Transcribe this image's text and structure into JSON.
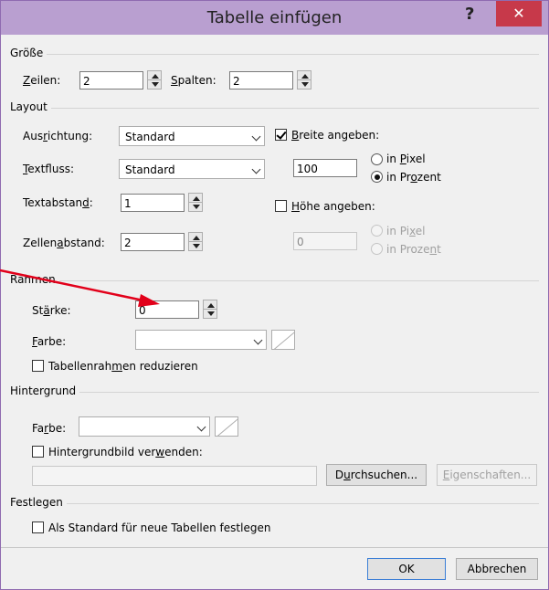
{
  "window": {
    "title": "Tabelle einfügen",
    "help": "?",
    "close": "✕"
  },
  "groesse": {
    "group": "Größe",
    "zeilen_label": "Zeilen:",
    "zeilen_value": "2",
    "spalten_label": "Spalten:",
    "spalten_value": "2"
  },
  "layout": {
    "group": "Layout",
    "ausrichtung_label": "Ausrichtung:",
    "ausrichtung_value": "Standard",
    "textfluss_label": "Textfluss:",
    "textfluss_value": "Standard",
    "textabstand_label": "Textabstand:",
    "textabstand_value": "1",
    "zellenabstand_label": "Zellenabstand:",
    "zellenabstand_value": "2",
    "breite_label": "Breite angeben:",
    "breite_checked": true,
    "breite_value": "100",
    "breite_pixel": "in Pixel",
    "breite_prozent": "in Prozent",
    "hoehe_label": "Höhe angeben:",
    "hoehe_checked": false,
    "hoehe_value": "0",
    "hoehe_pixel": "in Pixel",
    "hoehe_prozent": "in Prozent"
  },
  "rahmen": {
    "group": "Rahmen",
    "staerke_label": "Stärke:",
    "staerke_value": "0",
    "farbe_label": "Farbe:",
    "farbe_value": "",
    "reduzieren_label": "Tabellenrahmen reduzieren"
  },
  "hintergrund": {
    "group": "Hintergrund",
    "farbe_label": "Farbe:",
    "farbe_value": "",
    "bild_label": "Hintergrundbild verwenden:",
    "pfad_value": "",
    "durchsuchen": "Durchsuchen...",
    "eigenschaften": "Eigenschaften..."
  },
  "festlegen": {
    "group": "Festlegen",
    "standard_label": "Als Standard für neue Tabellen festlegen"
  },
  "buttons": {
    "ok": "OK",
    "abbrechen": "Abbrechen"
  },
  "colors": {
    "title_bar": "#b99fd0",
    "close_button": "#c7394a",
    "annotation_arrow": "#e2001a"
  }
}
